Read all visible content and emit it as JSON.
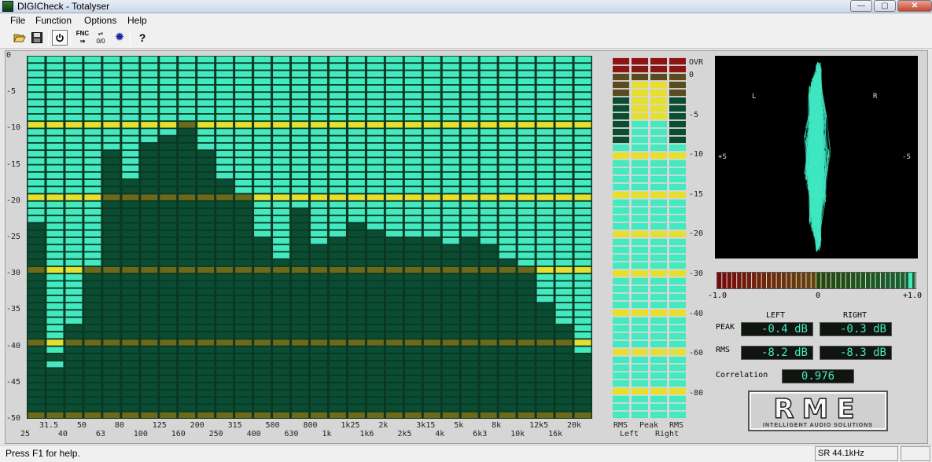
{
  "window": {
    "title": "DIGICheck - Totalyser",
    "min": "—",
    "max": "▢",
    "close": "✕"
  },
  "menu": [
    "File",
    "Function",
    "Options",
    "Help"
  ],
  "toolbar": {
    "fnc": "FNC",
    "calib": "0/0"
  },
  "colors": {
    "background": "#0b4d33",
    "bar": "#43e9bf",
    "bar_peak_hold": "#47e6c0",
    "grid_line": "#e6df2e",
    "over": "#8b1414",
    "meter_frame": "#5a4c3c"
  },
  "chart_data": [
    {
      "type": "bar",
      "name": "third-octave-analyzer",
      "categories": [
        "25",
        "31.5",
        "40",
        "50",
        "63",
        "80",
        "100",
        "125",
        "160",
        "200",
        "250",
        "315",
        "400",
        "500",
        "630",
        "800",
        "1k",
        "1k25",
        "1k6",
        "2k",
        "2k5",
        "3k15",
        "4k",
        "5k",
        "6k3",
        "8k",
        "10k",
        "12k5",
        "16k",
        "20k"
      ],
      "values": [
        -22,
        -41,
        -37,
        -29,
        -13,
        -17,
        -11,
        -10,
        -9,
        -12,
        -16,
        -19,
        -25,
        -28,
        -21,
        -25,
        -24,
        -23,
        -24,
        -25,
        -24,
        -24,
        -25,
        -24,
        -25,
        -27,
        -29,
        -33,
        -37,
        -41
      ],
      "peak_hold": [
        -22,
        -42,
        -32,
        -29,
        -9,
        -9,
        -11,
        -10,
        -9,
        -12,
        -16,
        -19,
        -24,
        -20,
        -19,
        -25,
        -24,
        -18,
        -22,
        -23,
        -24,
        -24,
        -25,
        -24,
        -25,
        -27,
        -29,
        -33,
        -35,
        -39
      ],
      "yticks": [
        "0",
        "-5",
        "-10",
        "-15",
        "-20",
        "-25",
        "-30",
        "-35",
        "-40",
        "-45",
        "-50"
      ],
      "xticks_top": [
        "31.5",
        "50",
        "80",
        "125",
        "200",
        "315",
        "500",
        "800",
        "1k25",
        "2k",
        "3k15",
        "5k",
        "8k",
        "12k5",
        "20k"
      ],
      "xticks_bottom": [
        "25",
        "40",
        "63",
        "100",
        "160",
        "250",
        "400",
        "630",
        "1k",
        "1k6",
        "2k5",
        "4k",
        "6k3",
        "10k",
        "16k"
      ],
      "ylim": [
        -50,
        0
      ]
    },
    {
      "type": "bar",
      "name": "level-meters",
      "categories": [
        "RMS Left",
        "Peak Left",
        "Peak Right",
        "RMS Right"
      ],
      "values": [
        -8.2,
        -0.4,
        -0.3,
        -8.3
      ],
      "scale_labels": [
        "OVR",
        "0",
        "-5",
        "-10",
        "-15",
        "-20",
        "-30",
        "-40",
        "-60",
        "-80"
      ],
      "bottom_labels": [
        "RMS",
        "Peak",
        "RMS",
        "Left",
        "Right"
      ]
    }
  ],
  "xy_scope": {
    "l": "L",
    "r": "R",
    "plus_s": "+S",
    "minus_s": "-S"
  },
  "correlation_meter": {
    "min": "-1.0",
    "mid": "0",
    "max": "+1.0",
    "value": 0.976
  },
  "readouts": {
    "left_header": "LEFT",
    "right_header": "RIGHT",
    "peak_label": "PEAK",
    "rms_label": "RMS",
    "peak_left": "-0.4 dB",
    "peak_right": "-0.3 dB",
    "rms_left": "-8.2 dB",
    "rms_right": "-8.3 dB",
    "correlation_label": "Correlation",
    "correlation_value": "0.976"
  },
  "logo": {
    "word": "RME",
    "tagline": "INTELLIGENT AUDIO SOLUTIONS"
  },
  "status": {
    "help": "Press F1 for help.",
    "sample_rate": "SR 44.1kHz"
  }
}
